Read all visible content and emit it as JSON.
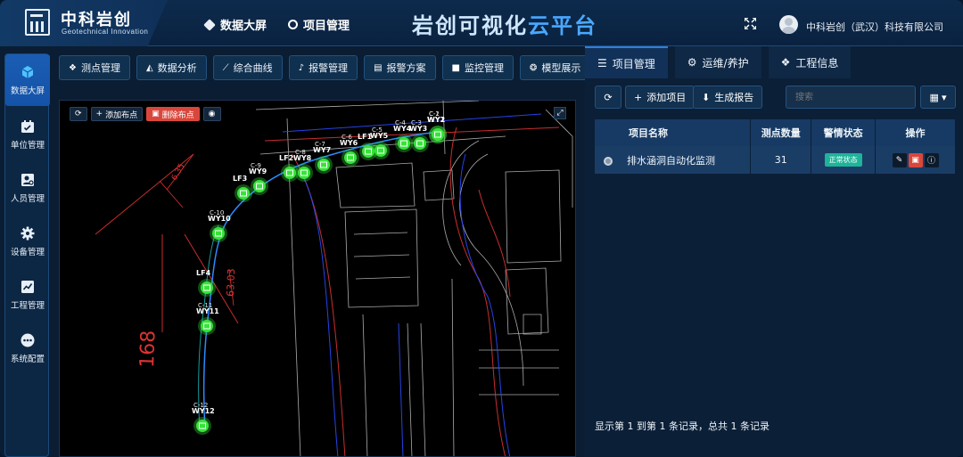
{
  "header": {
    "logo_title": "中科岩创",
    "logo_subtitle": "Geotechnical Innovation",
    "nav": [
      {
        "label": "数据大屏",
        "icon": "cube-icon"
      },
      {
        "label": "项目管理",
        "icon": "ring-icon"
      }
    ],
    "platform_title_a": "岩创可视化",
    "platform_title_b": "云平台",
    "company": "中科岩创（武汉）科技有限公司"
  },
  "sidebar": {
    "items": [
      {
        "label": "数据大屏",
        "icon": "cube-icon",
        "active": true
      },
      {
        "label": "单位管理",
        "icon": "calendar-icon"
      },
      {
        "label": "人员管理",
        "icon": "person-card-icon"
      },
      {
        "label": "设备管理",
        "icon": "gear-icon"
      },
      {
        "label": "工程管理",
        "icon": "chart-icon"
      },
      {
        "label": "系统配置",
        "icon": "dots-icon"
      }
    ]
  },
  "toolbar": {
    "items": [
      {
        "label": "测点管理",
        "icon": "cubes-icon"
      },
      {
        "label": "数据分析",
        "icon": "area-chart-icon"
      },
      {
        "label": "综合曲线",
        "icon": "line-chart-icon"
      },
      {
        "label": "报警管理",
        "icon": "bell-icon"
      },
      {
        "label": "报警方案",
        "icon": "book-icon"
      },
      {
        "label": "监控管理",
        "icon": "camera-icon"
      },
      {
        "label": "模型展示",
        "icon": "model-icon"
      }
    ]
  },
  "map": {
    "tools": {
      "add_point": "添加布点",
      "delete_point": "删除布点"
    },
    "dim_labels": [
      "168",
      "63.03",
      "6.35"
    ],
    "points": [
      {
        "label": "WY12",
        "code": "C-12"
      },
      {
        "label": "WY11",
        "code": "C-11"
      },
      {
        "label": "LF4",
        "code": ""
      },
      {
        "label": "WY10",
        "code": "C-10"
      },
      {
        "label": "WY9",
        "code": "C-9"
      },
      {
        "label": "LF3",
        "code": ""
      },
      {
        "label": "WY8",
        "code": "C-8"
      },
      {
        "label": "LF2",
        "code": ""
      },
      {
        "label": "WY7",
        "code": "C-7"
      },
      {
        "label": "WY6",
        "code": "C-6"
      },
      {
        "label": "LF1",
        "code": ""
      },
      {
        "label": "WY5",
        "code": "C-5"
      },
      {
        "label": "WY4",
        "code": "C-4"
      },
      {
        "label": "WY3",
        "code": "C-3"
      },
      {
        "label": "WY2",
        "code": "C-2"
      },
      {
        "label": "WY1",
        "code": "C-1"
      }
    ]
  },
  "right_panel": {
    "tabs": [
      {
        "label": "项目管理",
        "icon": "list-icon",
        "active": true
      },
      {
        "label": "运维/养护",
        "icon": "cogs-icon"
      },
      {
        "label": "工程信息",
        "icon": "cubes-icon"
      }
    ],
    "add_label": "添加项目",
    "report_label": "生成报告",
    "search_placeholder": "搜索",
    "table": {
      "headers": [
        "项目名称",
        "测点数量",
        "警情状态",
        "操作"
      ],
      "rows": [
        {
          "name": "排水涵洞自动化监测",
          "count": "31",
          "status": "正常状态"
        }
      ]
    },
    "footer": "显示第 1 到第 1 条记录，总共 1 条记录"
  },
  "colors": {
    "accent": "#2f7fd8",
    "status_ok": "#1fb39a",
    "danger": "#d9473c",
    "point_green": "#37e33a"
  }
}
